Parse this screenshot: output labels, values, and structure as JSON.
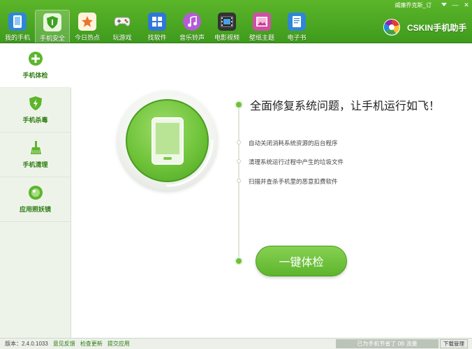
{
  "titlebar": {
    "user": "威廉乔克斯_订",
    "menu_icon": "dropdown-icon",
    "minimize": "—",
    "close": "✕"
  },
  "brand": {
    "name": "CSKIN手机助手"
  },
  "nav": [
    {
      "label": "我的手机",
      "icon": "phone-icon",
      "color": "#3a8fd8"
    },
    {
      "label": "手机安全",
      "icon": "shield-icon",
      "color": "#3fa123"
    },
    {
      "label": "今日热点",
      "icon": "star-icon",
      "color": "#e8a22a"
    },
    {
      "label": "玩游戏",
      "icon": "gamepad-icon",
      "color": "#ffffff"
    },
    {
      "label": "找软件",
      "icon": "apps-icon",
      "color": "#3a7fd8"
    },
    {
      "label": "音乐铃声",
      "icon": "music-icon",
      "color": "#b35cd6"
    },
    {
      "label": "电影视频",
      "icon": "film-icon",
      "color": "#333333"
    },
    {
      "label": "壁纸主题",
      "icon": "wallpaper-icon",
      "color": "#d14fa8"
    },
    {
      "label": "电子书",
      "icon": "book-icon",
      "color": "#3a8fd8"
    }
  ],
  "sidebar": [
    {
      "label": "手机体检",
      "icon": "plus-circle-icon"
    },
    {
      "label": "手机杀毒",
      "icon": "lightning-shield-icon"
    },
    {
      "label": "手机清理",
      "icon": "broom-icon"
    },
    {
      "label": "应用照妖镜",
      "icon": "mirror-icon"
    }
  ],
  "main": {
    "headline": "全面修复系统问题，让手机运行如飞！",
    "features": [
      "自动关闭消耗系统资源的后台程序",
      "清理系统运行过程中产生的垃圾文件",
      "扫描并查杀手机里的恶意扣费软件"
    ],
    "check_button": "一键体检"
  },
  "status": {
    "version": "版本：2.4.0.1033",
    "links": [
      "意见反馈",
      "检查更新",
      "提交应用"
    ],
    "saved": "已为手机节省了 0B 流量",
    "download_btn": "下载管理"
  },
  "colors": {
    "brand_green": "#4caf22",
    "accent": "#6dc13a"
  }
}
